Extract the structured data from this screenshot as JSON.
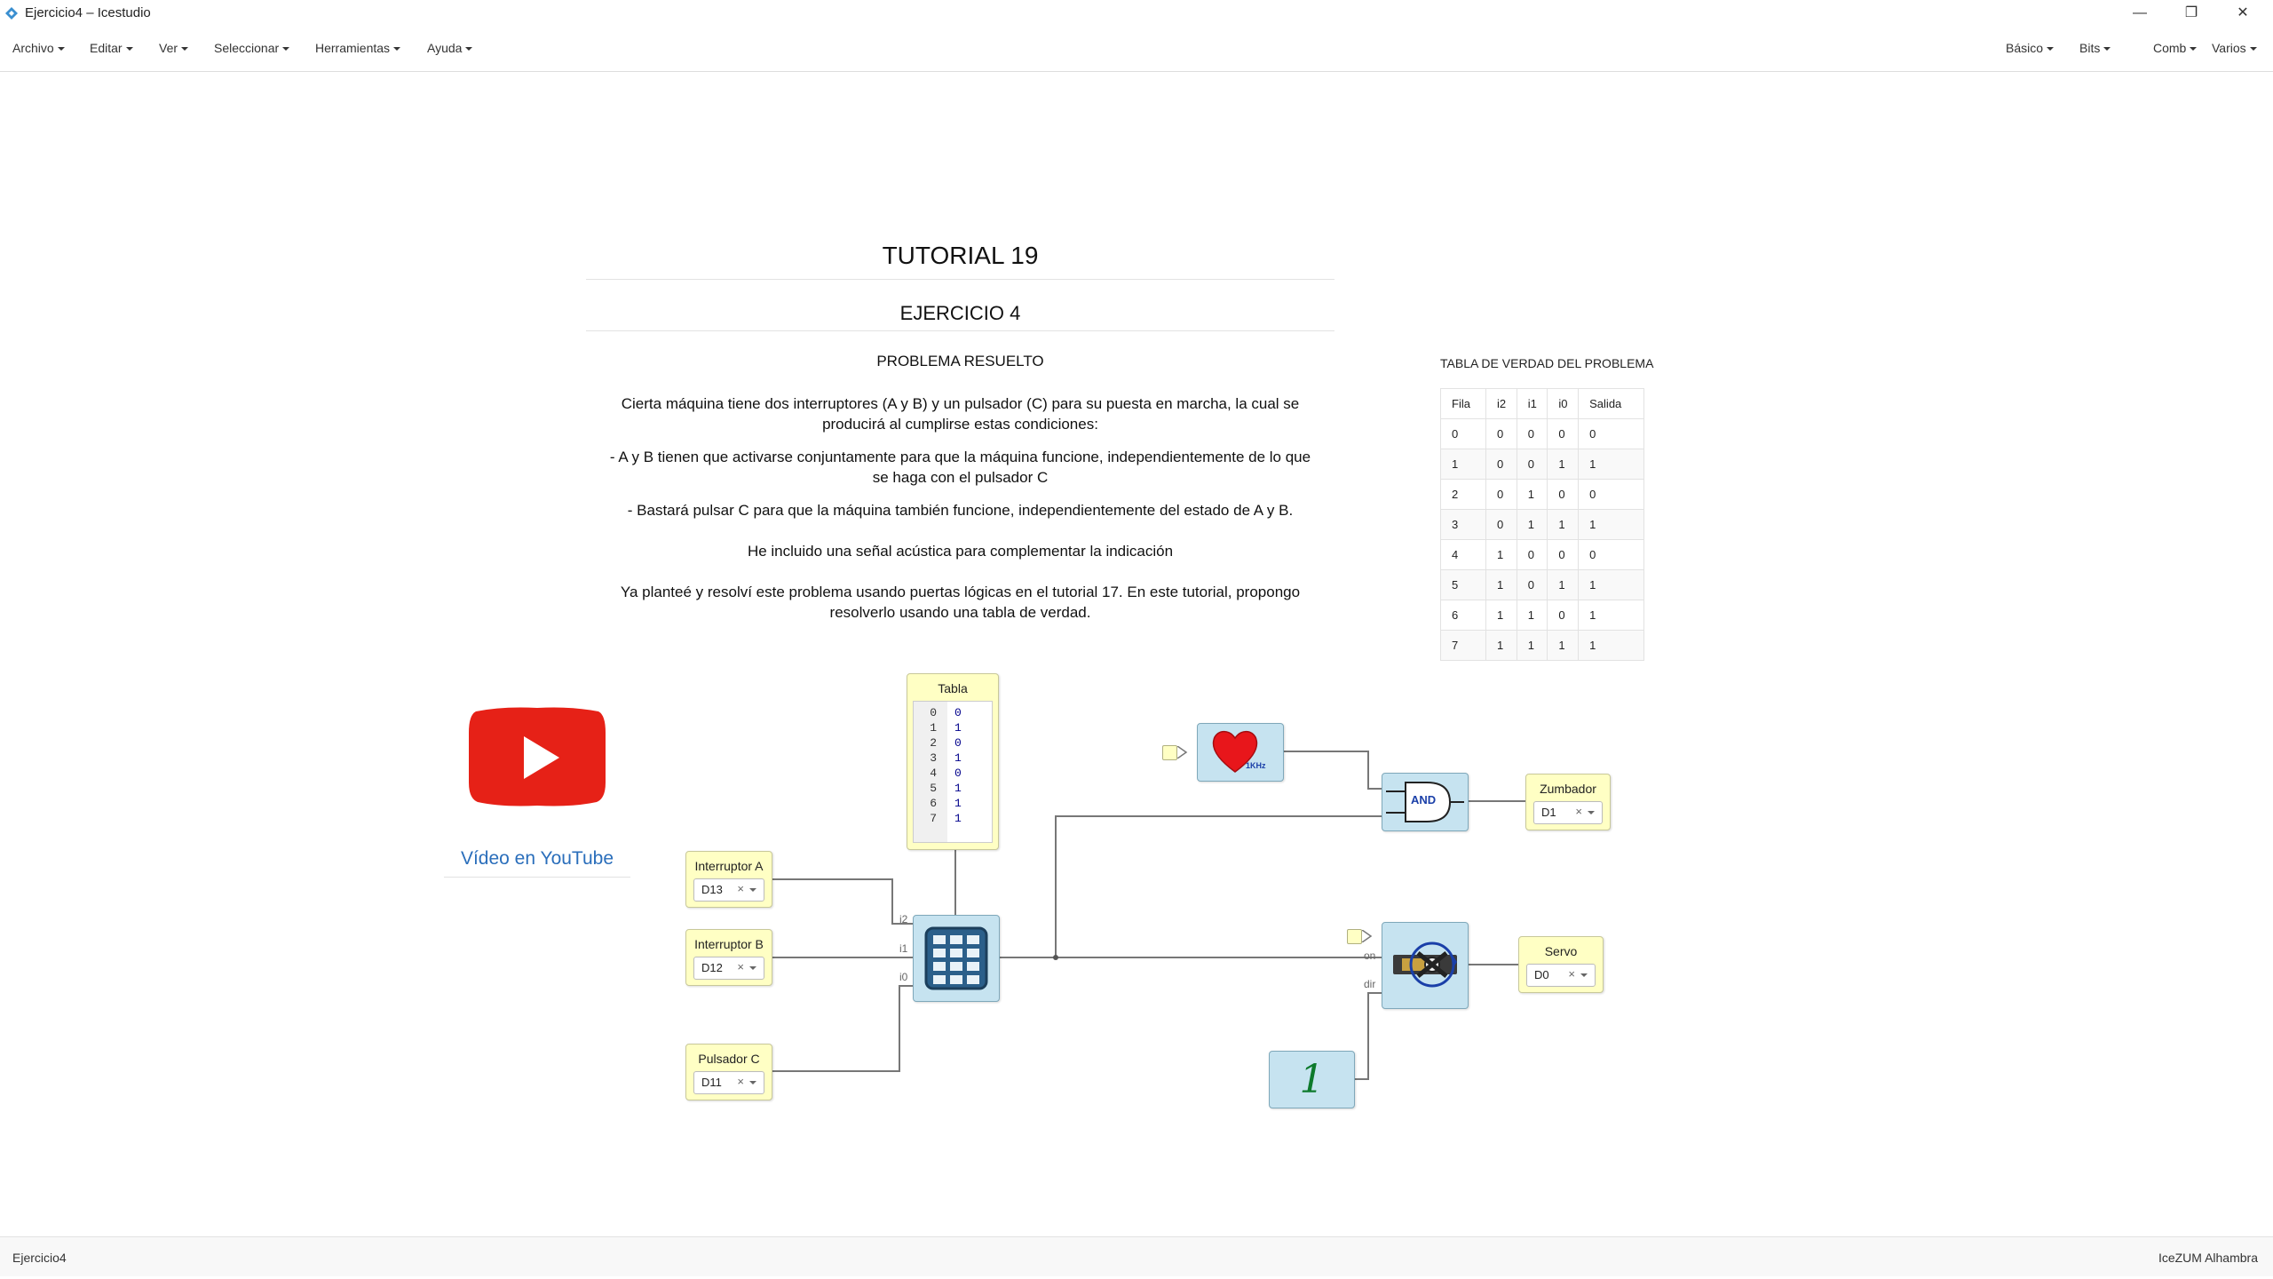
{
  "window": {
    "title": "Ejercicio4 – Icestudio",
    "minimize": "—",
    "restore": "❐",
    "close": "✕"
  },
  "menu": {
    "left": [
      "Archivo",
      "Editar",
      "Ver",
      "Seleccionar",
      "Herramientas",
      "Ayuda"
    ],
    "right": [
      "Básico",
      "Bits",
      "Comb",
      "Varios"
    ]
  },
  "doc": {
    "title": "TUTORIAL 19",
    "subtitle": "EJERCICIO 4",
    "section": "PROBLEMA RESUELTO",
    "p1a": "Cierta máquina tiene dos interruptores (A y B) y un pulsador (C) para su puesta en marcha, la cual se",
    "p1b": "producirá al cumplirse estas condiciones:",
    "p2a": "- A y B tienen que activarse conjuntamente para que la máquina funcione, independientemente de lo que",
    "p2b": "se haga con el pulsador C",
    "p3": "- Bastará pulsar C para que la máquina también funcione, independientemente del estado de A y B.",
    "p4": "He incluido una señal acústica para complementar la indicación",
    "p5a": "Ya planteé y resolví este problema usando puertas lógicas en el tutorial 17. En este tutorial, propongo",
    "p5b": "resolverlo usando una tabla de verdad."
  },
  "truth": {
    "caption": "TABLA DE VERDAD DEL PROBLEMA",
    "headers": [
      "Fila",
      "i2",
      "i1",
      "i0",
      "Salida"
    ],
    "rows": [
      [
        "0",
        "0",
        "0",
        "0",
        "0"
      ],
      [
        "1",
        "0",
        "0",
        "1",
        "1"
      ],
      [
        "2",
        "0",
        "1",
        "0",
        "0"
      ],
      [
        "3",
        "0",
        "1",
        "1",
        "1"
      ],
      [
        "4",
        "1",
        "0",
        "0",
        "0"
      ],
      [
        "5",
        "1",
        "0",
        "1",
        "1"
      ],
      [
        "6",
        "1",
        "1",
        "0",
        "1"
      ],
      [
        "7",
        "1",
        "1",
        "1",
        "1"
      ]
    ]
  },
  "youtube": {
    "link": "Vídeo en YouTube",
    "brand_color": "#e62117"
  },
  "blocks": {
    "tabla": {
      "title": "Tabla",
      "lines": "0\n1\n2\n3\n4\n5\n6\n7",
      "values": "0\n1\n0\n1\n0\n1\n1\n1"
    },
    "interruptor_a": {
      "label": "Interruptor A",
      "pin": "D13"
    },
    "interruptor_b": {
      "label": "Interruptor B",
      "pin": "D12"
    },
    "pulsador_c": {
      "label": "Pulsador C",
      "pin": "D11"
    },
    "zumbador": {
      "label": "Zumbador",
      "pin": "D1"
    },
    "servo": {
      "label": "Servo",
      "pin": "D0"
    },
    "and_gate": {
      "label": "AND"
    },
    "heart": {
      "label": "1KHz"
    },
    "constant": {
      "label": "1"
    },
    "ports": {
      "i2": "i2",
      "i1": "i1",
      "i0": "i0",
      "on": "on",
      "dir": "dir"
    },
    "clear": "×"
  },
  "status": {
    "left": "Ejercicio4",
    "right": "IceZUM Alhambra"
  }
}
